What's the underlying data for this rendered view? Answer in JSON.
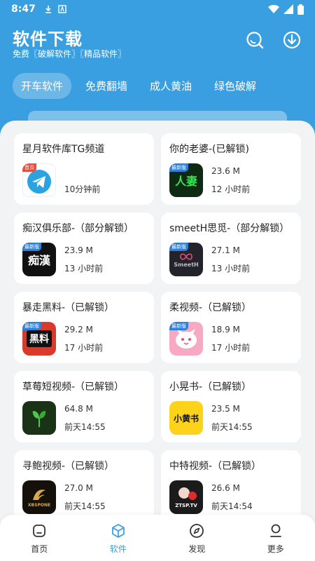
{
  "status": {
    "time": "8:47"
  },
  "header": {
    "title": "软件下载",
    "subtitle": "免费〖破解软件〗〖精品软件〗"
  },
  "tabs": [
    {
      "label": "开车软件",
      "active": true
    },
    {
      "label": "免费翻墙",
      "active": false
    },
    {
      "label": "成人黄油",
      "active": false
    },
    {
      "label": "绿色破解",
      "active": false
    }
  ],
  "apps": [
    {
      "title": "星月软件库TG频道",
      "size": "",
      "time": "10分钟前",
      "icon": "telegram-icon",
      "tag": "首页"
    },
    {
      "title": "你的老婆-(已解锁)",
      "size": "23.6 M",
      "time": "12 小时前",
      "icon": "laopo-icon",
      "tag": "最新版",
      "icon_text": "人妻"
    },
    {
      "title": "痴汉俱乐部-（部分解锁）",
      "size": "23.9 M",
      "time": "13 小时前",
      "icon": "chihan-icon",
      "tag": "最新版",
      "icon_text": "痴漢"
    },
    {
      "title": "smeetH思觅-（部分解锁）",
      "size": "27.1 M",
      "time": "13 小时前",
      "icon": "smeeth-icon",
      "tag": "最新版",
      "icon_text": "SmeetH"
    },
    {
      "title": "暴走黑料-（已解锁）",
      "size": "29.2 M",
      "time": "17 小时前",
      "icon": "heiliao-icon",
      "tag": "最新版",
      "icon_text": "黑料"
    },
    {
      "title": "柔视频-（已解锁）",
      "size": "18.9 M",
      "time": "17 小时前",
      "icon": "rou-icon",
      "tag": "最新版",
      "icon_text": ""
    },
    {
      "title": "草莓短视频-（已解锁）",
      "size": "64.8 M",
      "time": "前天14:55",
      "icon": "caomei-icon",
      "tag": "",
      "icon_text": ""
    },
    {
      "title": "小晃书-（已解锁）",
      "size": "23.5 M",
      "time": "前天14:55",
      "icon": "xiaohuangshu-icon",
      "tag": "",
      "icon_text": "小黄书"
    },
    {
      "title": "寻鲍视频-（已解锁）",
      "size": "27.0 M",
      "time": "前天14:55",
      "icon": "xunbao-icon",
      "tag": "",
      "icon_text": "XBSPONE"
    },
    {
      "title": "中特视频-（已解锁）",
      "size": "26.6 M",
      "time": "前天14:54",
      "icon": "zhongte-icon",
      "tag": "",
      "icon_text": "ZTSP.TV"
    }
  ],
  "bottom_nav": [
    {
      "label": "首页",
      "icon": "home-icon",
      "active": false
    },
    {
      "label": "软件",
      "icon": "cube-icon",
      "active": true
    },
    {
      "label": "发现",
      "icon": "compass-icon",
      "active": false
    },
    {
      "label": "更多",
      "icon": "person-icon",
      "active": false
    }
  ],
  "colors": {
    "primary": "#3a9fe0",
    "background": "#f2f3f5",
    "card": "#ffffff"
  }
}
